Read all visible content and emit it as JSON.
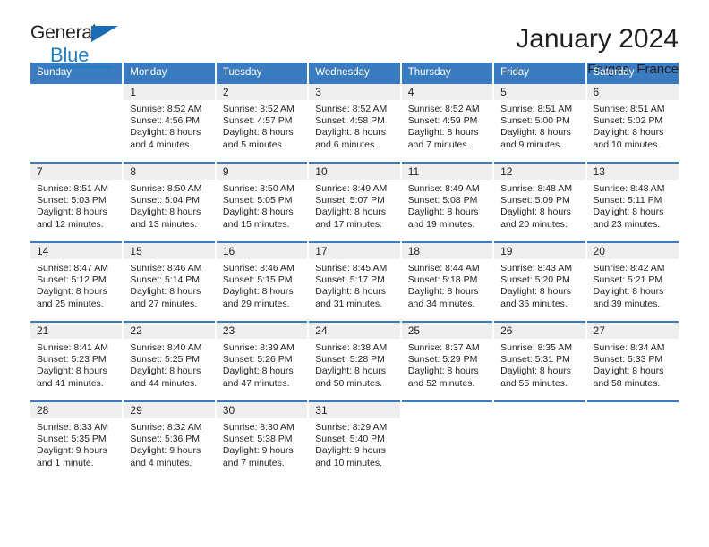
{
  "logo": {
    "name_top": "General",
    "name_bottom": "Blue",
    "triangle_color": "#1b6cb5",
    "blue": "#1f7ec4"
  },
  "header": {
    "title": "January 2024",
    "subtitle": "Fruges, France"
  },
  "theme": {
    "header_blue": "#3b7cc0",
    "daynum_band": "#efeff0",
    "text": "#231f20",
    "cell_bg": "#ffffff"
  },
  "weekdays": [
    "Sunday",
    "Monday",
    "Tuesday",
    "Wednesday",
    "Thursday",
    "Friday",
    "Saturday"
  ],
  "weeks": [
    [
      {
        "day": "",
        "sunrise": "",
        "sunset": "",
        "daylight": ""
      },
      {
        "day": "1",
        "sunrise": "Sunrise: 8:52 AM",
        "sunset": "Sunset: 4:56 PM",
        "daylight": "Daylight: 8 hours and 4 minutes."
      },
      {
        "day": "2",
        "sunrise": "Sunrise: 8:52 AM",
        "sunset": "Sunset: 4:57 PM",
        "daylight": "Daylight: 8 hours and 5 minutes."
      },
      {
        "day": "3",
        "sunrise": "Sunrise: 8:52 AM",
        "sunset": "Sunset: 4:58 PM",
        "daylight": "Daylight: 8 hours and 6 minutes."
      },
      {
        "day": "4",
        "sunrise": "Sunrise: 8:52 AM",
        "sunset": "Sunset: 4:59 PM",
        "daylight": "Daylight: 8 hours and 7 minutes."
      },
      {
        "day": "5",
        "sunrise": "Sunrise: 8:51 AM",
        "sunset": "Sunset: 5:00 PM",
        "daylight": "Daylight: 8 hours and 9 minutes."
      },
      {
        "day": "6",
        "sunrise": "Sunrise: 8:51 AM",
        "sunset": "Sunset: 5:02 PM",
        "daylight": "Daylight: 8 hours and 10 minutes."
      }
    ],
    [
      {
        "day": "7",
        "sunrise": "Sunrise: 8:51 AM",
        "sunset": "Sunset: 5:03 PM",
        "daylight": "Daylight: 8 hours and 12 minutes."
      },
      {
        "day": "8",
        "sunrise": "Sunrise: 8:50 AM",
        "sunset": "Sunset: 5:04 PM",
        "daylight": "Daylight: 8 hours and 13 minutes."
      },
      {
        "day": "9",
        "sunrise": "Sunrise: 8:50 AM",
        "sunset": "Sunset: 5:05 PM",
        "daylight": "Daylight: 8 hours and 15 minutes."
      },
      {
        "day": "10",
        "sunrise": "Sunrise: 8:49 AM",
        "sunset": "Sunset: 5:07 PM",
        "daylight": "Daylight: 8 hours and 17 minutes."
      },
      {
        "day": "11",
        "sunrise": "Sunrise: 8:49 AM",
        "sunset": "Sunset: 5:08 PM",
        "daylight": "Daylight: 8 hours and 19 minutes."
      },
      {
        "day": "12",
        "sunrise": "Sunrise: 8:48 AM",
        "sunset": "Sunset: 5:09 PM",
        "daylight": "Daylight: 8 hours and 20 minutes."
      },
      {
        "day": "13",
        "sunrise": "Sunrise: 8:48 AM",
        "sunset": "Sunset: 5:11 PM",
        "daylight": "Daylight: 8 hours and 23 minutes."
      }
    ],
    [
      {
        "day": "14",
        "sunrise": "Sunrise: 8:47 AM",
        "sunset": "Sunset: 5:12 PM",
        "daylight": "Daylight: 8 hours and 25 minutes."
      },
      {
        "day": "15",
        "sunrise": "Sunrise: 8:46 AM",
        "sunset": "Sunset: 5:14 PM",
        "daylight": "Daylight: 8 hours and 27 minutes."
      },
      {
        "day": "16",
        "sunrise": "Sunrise: 8:46 AM",
        "sunset": "Sunset: 5:15 PM",
        "daylight": "Daylight: 8 hours and 29 minutes."
      },
      {
        "day": "17",
        "sunrise": "Sunrise: 8:45 AM",
        "sunset": "Sunset: 5:17 PM",
        "daylight": "Daylight: 8 hours and 31 minutes."
      },
      {
        "day": "18",
        "sunrise": "Sunrise: 8:44 AM",
        "sunset": "Sunset: 5:18 PM",
        "daylight": "Daylight: 8 hours and 34 minutes."
      },
      {
        "day": "19",
        "sunrise": "Sunrise: 8:43 AM",
        "sunset": "Sunset: 5:20 PM",
        "daylight": "Daylight: 8 hours and 36 minutes."
      },
      {
        "day": "20",
        "sunrise": "Sunrise: 8:42 AM",
        "sunset": "Sunset: 5:21 PM",
        "daylight": "Daylight: 8 hours and 39 minutes."
      }
    ],
    [
      {
        "day": "21",
        "sunrise": "Sunrise: 8:41 AM",
        "sunset": "Sunset: 5:23 PM",
        "daylight": "Daylight: 8 hours and 41 minutes."
      },
      {
        "day": "22",
        "sunrise": "Sunrise: 8:40 AM",
        "sunset": "Sunset: 5:25 PM",
        "daylight": "Daylight: 8 hours and 44 minutes."
      },
      {
        "day": "23",
        "sunrise": "Sunrise: 8:39 AM",
        "sunset": "Sunset: 5:26 PM",
        "daylight": "Daylight: 8 hours and 47 minutes."
      },
      {
        "day": "24",
        "sunrise": "Sunrise: 8:38 AM",
        "sunset": "Sunset: 5:28 PM",
        "daylight": "Daylight: 8 hours and 50 minutes."
      },
      {
        "day": "25",
        "sunrise": "Sunrise: 8:37 AM",
        "sunset": "Sunset: 5:29 PM",
        "daylight": "Daylight: 8 hours and 52 minutes."
      },
      {
        "day": "26",
        "sunrise": "Sunrise: 8:35 AM",
        "sunset": "Sunset: 5:31 PM",
        "daylight": "Daylight: 8 hours and 55 minutes."
      },
      {
        "day": "27",
        "sunrise": "Sunrise: 8:34 AM",
        "sunset": "Sunset: 5:33 PM",
        "daylight": "Daylight: 8 hours and 58 minutes."
      }
    ],
    [
      {
        "day": "28",
        "sunrise": "Sunrise: 8:33 AM",
        "sunset": "Sunset: 5:35 PM",
        "daylight": "Daylight: 9 hours and 1 minute."
      },
      {
        "day": "29",
        "sunrise": "Sunrise: 8:32 AM",
        "sunset": "Sunset: 5:36 PM",
        "daylight": "Daylight: 9 hours and 4 minutes."
      },
      {
        "day": "30",
        "sunrise": "Sunrise: 8:30 AM",
        "sunset": "Sunset: 5:38 PM",
        "daylight": "Daylight: 9 hours and 7 minutes."
      },
      {
        "day": "31",
        "sunrise": "Sunrise: 8:29 AM",
        "sunset": "Sunset: 5:40 PM",
        "daylight": "Daylight: 9 hours and 10 minutes."
      },
      {
        "day": "",
        "sunrise": "",
        "sunset": "",
        "daylight": ""
      },
      {
        "day": "",
        "sunrise": "",
        "sunset": "",
        "daylight": ""
      },
      {
        "day": "",
        "sunrise": "",
        "sunset": "",
        "daylight": ""
      }
    ]
  ]
}
